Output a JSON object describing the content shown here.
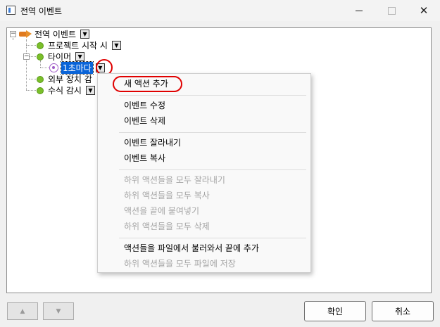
{
  "window": {
    "title": "전역 이벤트",
    "controls": {
      "minimize_icon": "minimize-icon",
      "maximize_icon": "maximize-icon",
      "close_icon": "close-icon",
      "close_glyph": "✕"
    }
  },
  "tree": {
    "expander_glyph": "−",
    "dropdown_glyph": "▼",
    "root": {
      "label": "전역 이벤트",
      "icon": "megaphone-icon"
    },
    "items": [
      {
        "label": "프로젝트 시작 시",
        "icon": "green-dot-icon"
      },
      {
        "label": "타이머",
        "icon": "green-dot-icon",
        "children": [
          {
            "label": "1초마다",
            "icon": "target-icon",
            "selected": true
          }
        ]
      },
      {
        "label": "외부 장치 감",
        "icon": "green-dot-icon"
      },
      {
        "label": "수식 감시",
        "icon": "green-dot-icon"
      }
    ]
  },
  "context_menu": {
    "groups": [
      [
        {
          "label": "새 액션 추가",
          "enabled": true,
          "highlighted": true
        }
      ],
      [
        {
          "label": "이벤트 수정",
          "enabled": true
        },
        {
          "label": "이벤트 삭제",
          "enabled": true
        }
      ],
      [
        {
          "label": "이벤트 잘라내기",
          "enabled": true
        },
        {
          "label": "이벤트 복사",
          "enabled": true
        }
      ],
      [
        {
          "label": "하위 액션들을 모두 잘라내기",
          "enabled": false
        },
        {
          "label": "하위 액션들을 모두 복사",
          "enabled": false
        },
        {
          "label": "액션을 끝에 붙여넣기",
          "enabled": false
        },
        {
          "label": "하위 액션들을 모두 삭제",
          "enabled": false
        }
      ],
      [
        {
          "label": "액션들을 파일에서 불러와서 끝에 추가",
          "enabled": true
        },
        {
          "label": "하위 액션들을 모두 파일에 저장",
          "enabled": false
        }
      ]
    ]
  },
  "footer": {
    "move_up_glyph": "▲",
    "move_down_glyph": "▼",
    "ok_label": "확인",
    "cancel_label": "취소"
  },
  "colors": {
    "selection": "#0a64d8",
    "annotation_red": "#e00000",
    "status_green": "#7bbf2a",
    "disabled_text": "#a5a5a5"
  }
}
